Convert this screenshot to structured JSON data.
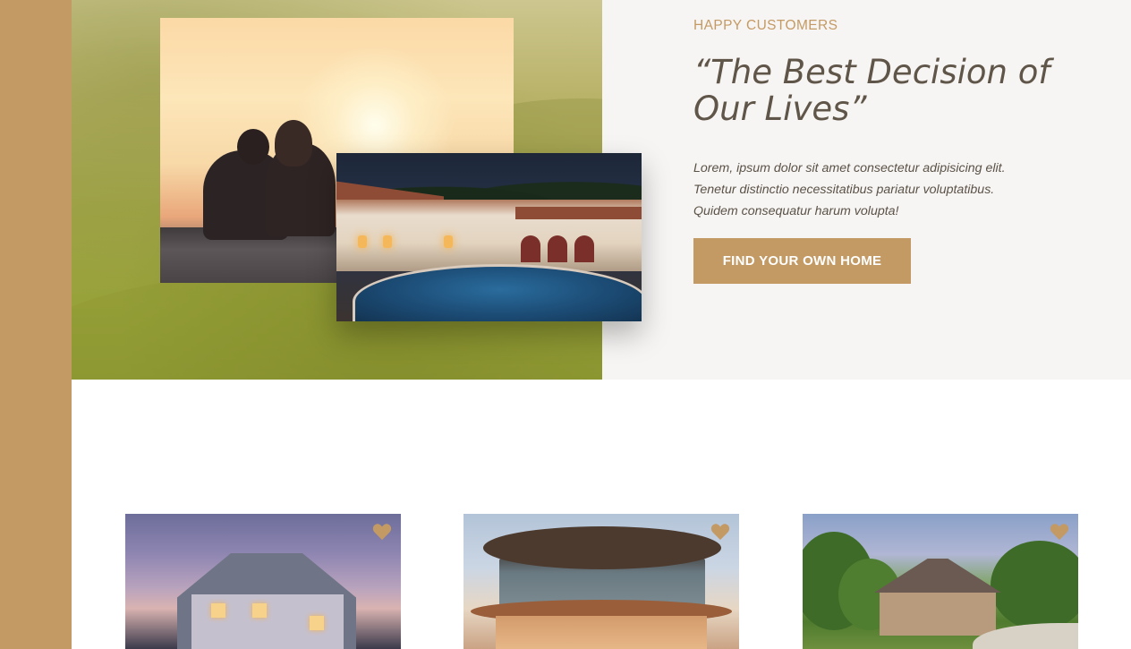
{
  "hero": {
    "eyebrow": "HAPPY CUSTOMERS",
    "quote": "“The Best Decision of Our Lives”",
    "body": "Lorem, ipsum dolor sit amet consectetur adipisicing elit. Tenetur distinctio necessitatibus pariatur voluptatibus. Quidem consequatur harum volupta!",
    "cta_label": "FIND YOUR OWN HOME"
  },
  "photos": {
    "couple": "couple-sunset-photo",
    "villa": "villa-pool-photo"
  },
  "cards": [
    {
      "image": "suburban-house-photo",
      "icon": "heart-icon"
    },
    {
      "image": "round-modern-building-photo",
      "icon": "heart-icon"
    },
    {
      "image": "stone-house-photo",
      "icon": "heart-icon"
    }
  ],
  "colors": {
    "accent": "#c49a64",
    "heading": "#5f5548",
    "body_text": "#5a5247",
    "panel_bg": "#f7f5f3"
  }
}
